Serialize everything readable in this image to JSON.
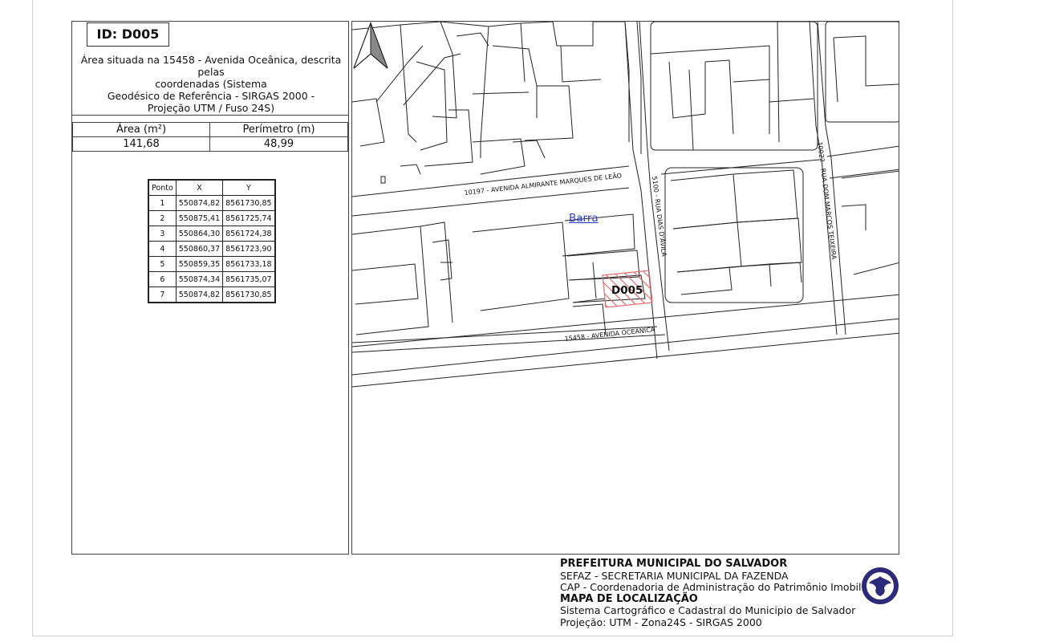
{
  "info": {
    "id_label": "ID: D005",
    "description": "Área situada na 15458 - Avenida Oceânica, descrita pelas\ncoordenadas (Sistema\nGeodésico de Referência - SIRGAS 2000 -\nProjeção UTM / Fuso 24S)",
    "area_header": "Área (m²)",
    "perimeter_header": "Perímetro (m)",
    "area_value": "141,68",
    "perimeter_value": "48,99"
  },
  "coord_table": {
    "headers": [
      "Ponto",
      "X",
      "Y"
    ],
    "rows": [
      [
        "1",
        "550874,82",
        "8561730,85"
      ],
      [
        "2",
        "550875,41",
        "8561725,74"
      ],
      [
        "3",
        "550864,30",
        "8561724,38"
      ],
      [
        "4",
        "550860,37",
        "8561723,90"
      ],
      [
        "5",
        "550859,35",
        "8561733,18"
      ],
      [
        "6",
        "550874,34",
        "8561735,07"
      ],
      [
        "7",
        "550874,82",
        "8561730,85"
      ]
    ]
  },
  "map": {
    "street_almirante": "10197 - AVENIDA ALMIRANTE MARQUES DE LEÃO",
    "street_oceanica": "15458 - AVENIDA OCEÂNICA",
    "street_dias": "5100 - RUA DIAS D'ÁVILA",
    "street_dom_marcos": "10022 - RUA DOM MARCOS TEIXEIRA",
    "parcel_label": "D005",
    "neighborhood_link": "Barra",
    "hatch_color": "#e07070"
  },
  "footer": {
    "line1": "PREFEITURA MUNICIPAL DO SALVADOR",
    "line2": "SEFAZ - SECRETARIA MUNICIPAL DA FAZENDA",
    "line3": "CAP - Coordenadoria de Administração do Patrimônio Imobiliár",
    "line4": "MAPA DE LOCALIZAÇÃO",
    "line5": "Sistema Cartográfico e Cadastral do Municipio de Salvador",
    "line6": "Projeção: UTM - Zona24S - SIRGAS 2000"
  },
  "seal_color": "#2e2a7a"
}
